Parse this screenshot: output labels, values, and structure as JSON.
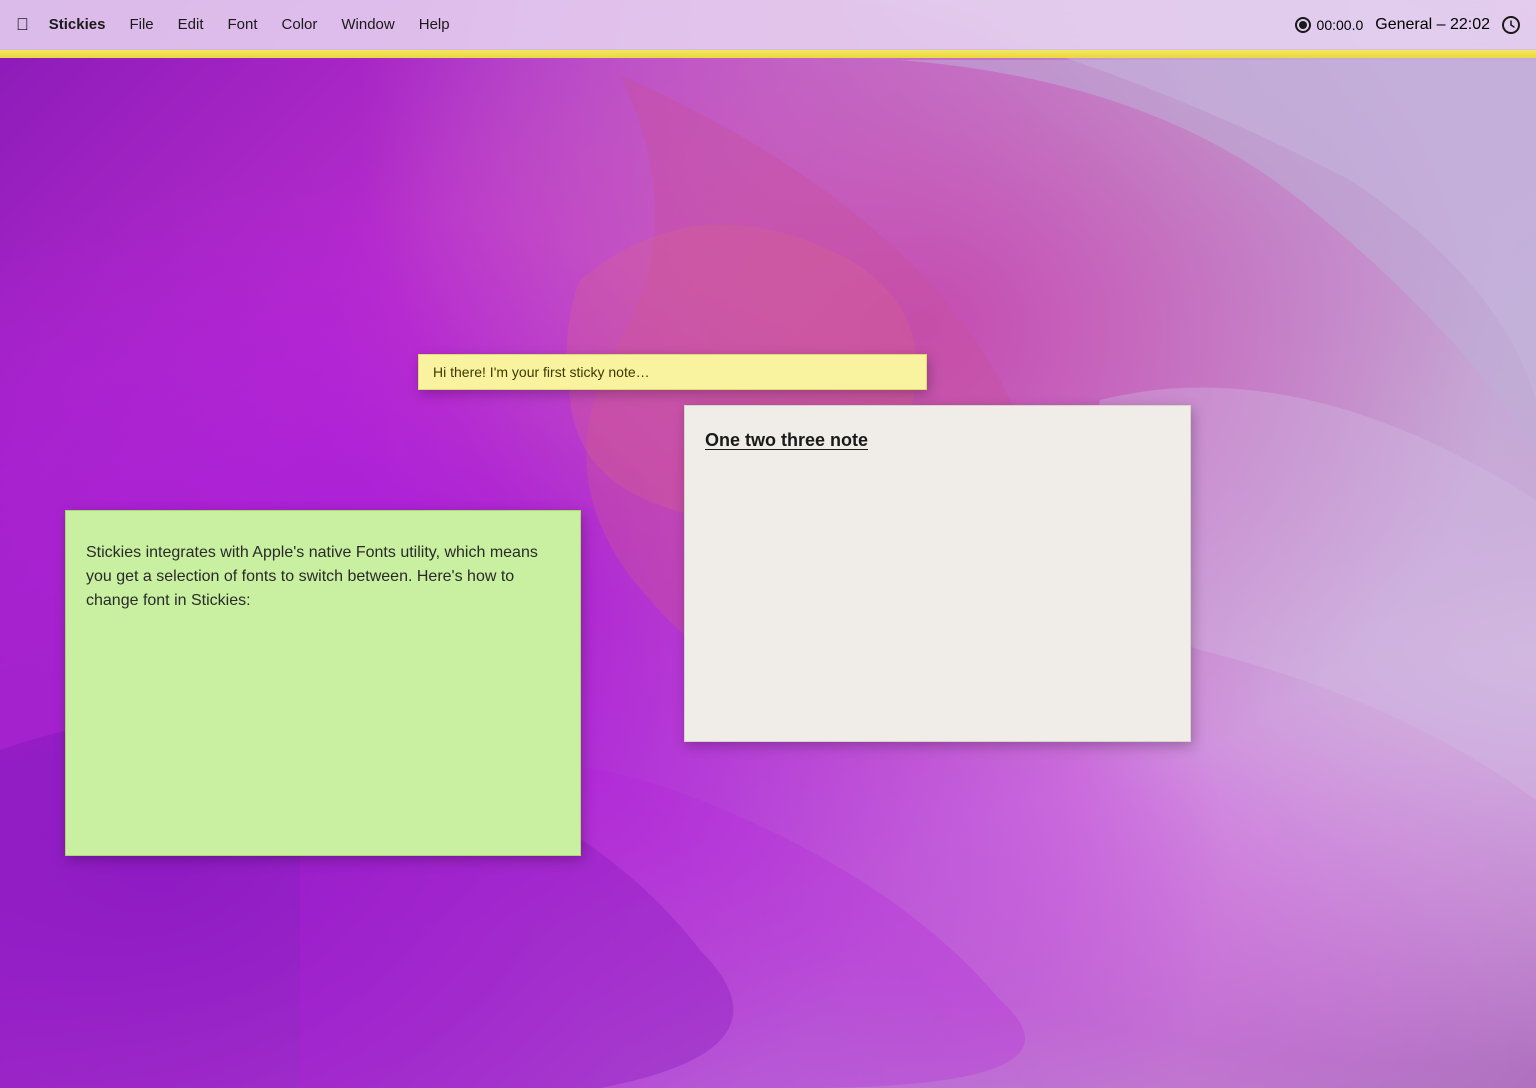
{
  "desktop": {
    "background_description": "macOS Monterey purple gradient"
  },
  "menubar": {
    "apple_label": "",
    "app_name": "Stickies",
    "items": [
      {
        "id": "file",
        "label": "File"
      },
      {
        "id": "edit",
        "label": "Edit"
      },
      {
        "id": "font",
        "label": "Font"
      },
      {
        "id": "color",
        "label": "Color"
      },
      {
        "id": "window",
        "label": "Window"
      },
      {
        "id": "help",
        "label": "Help"
      }
    ],
    "right": {
      "timer": "00:00.0",
      "general_time": "General – 22:02"
    }
  },
  "stickies": {
    "yellow": {
      "text": "Hi there! I'm your first sticky note…"
    },
    "green": {
      "content": "Stickies integrates with Apple's native Fonts utility, which means you get a selection of fonts to switch between. Here's how to change font in Stickies:"
    },
    "white": {
      "title": "One two three note"
    }
  }
}
